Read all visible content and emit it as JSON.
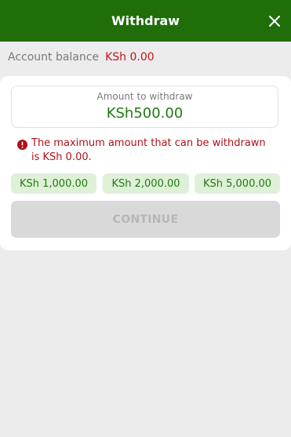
{
  "header": {
    "title": "Withdraw",
    "close_icon": "close-icon"
  },
  "balance": {
    "label": "Account balance",
    "value": "KSh 0.00"
  },
  "amount": {
    "label": "Amount to withdraw",
    "value": "KSh500.00"
  },
  "error": {
    "icon": "exclamation-circle-icon",
    "message": "The maximum amount that can be withdrawn is KSh 0.00."
  },
  "quick_amounts": [
    "KSh 1,000.00",
    "KSh 2,000.00",
    "KSh 5,000.00"
  ],
  "continue_label": "CONTINUE",
  "colors": {
    "header_bg": "#1f6e0a",
    "accent_green": "#1f7a12",
    "error_red": "#c0141b",
    "chip_bg": "#dff0d8",
    "disabled_bg": "#d9d9d9"
  }
}
